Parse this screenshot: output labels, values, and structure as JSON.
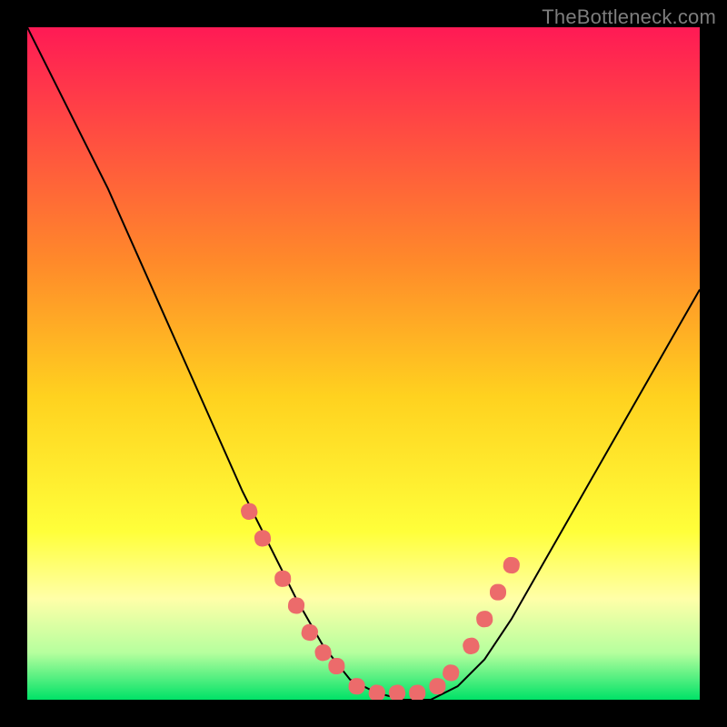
{
  "watermark": "TheBottleneck.com",
  "chart_data": {
    "type": "line",
    "title": "",
    "xlabel": "",
    "ylabel": "",
    "xlim": [
      0,
      100
    ],
    "ylim": [
      0,
      100
    ],
    "background_gradient": {
      "stops": [
        {
          "offset": 0,
          "color": "#ff1a55"
        },
        {
          "offset": 35,
          "color": "#ff8a2a"
        },
        {
          "offset": 55,
          "color": "#ffd21f"
        },
        {
          "offset": 75,
          "color": "#ffff3a"
        },
        {
          "offset": 85,
          "color": "#ffffa8"
        },
        {
          "offset": 93,
          "color": "#b6ff9e"
        },
        {
          "offset": 100,
          "color": "#00e267"
        }
      ]
    },
    "series": [
      {
        "name": "bottleneck-curve",
        "color": "#000000",
        "stroke_width": 2,
        "x": [
          0,
          4,
          8,
          12,
          16,
          20,
          24,
          28,
          32,
          36,
          40,
          44,
          48,
          52,
          56,
          60,
          64,
          68,
          72,
          76,
          80,
          84,
          88,
          92,
          96,
          100
        ],
        "y": [
          100,
          92,
          84,
          76,
          67,
          58,
          49,
          40,
          31,
          23,
          15,
          8,
          3,
          1,
          0,
          0,
          2,
          6,
          12,
          19,
          26,
          33,
          40,
          47,
          54,
          61
        ]
      }
    ],
    "markers": {
      "name": "highlighted-points",
      "color": "#ec6b6b",
      "size": 18,
      "points": [
        {
          "x": 33,
          "y": 28
        },
        {
          "x": 35,
          "y": 24
        },
        {
          "x": 38,
          "y": 18
        },
        {
          "x": 40,
          "y": 14
        },
        {
          "x": 42,
          "y": 10
        },
        {
          "x": 44,
          "y": 7
        },
        {
          "x": 46,
          "y": 5
        },
        {
          "x": 49,
          "y": 2
        },
        {
          "x": 52,
          "y": 1
        },
        {
          "x": 55,
          "y": 1
        },
        {
          "x": 58,
          "y": 1
        },
        {
          "x": 61,
          "y": 2
        },
        {
          "x": 63,
          "y": 4
        },
        {
          "x": 66,
          "y": 8
        },
        {
          "x": 68,
          "y": 12
        },
        {
          "x": 70,
          "y": 16
        },
        {
          "x": 72,
          "y": 20
        }
      ]
    }
  }
}
